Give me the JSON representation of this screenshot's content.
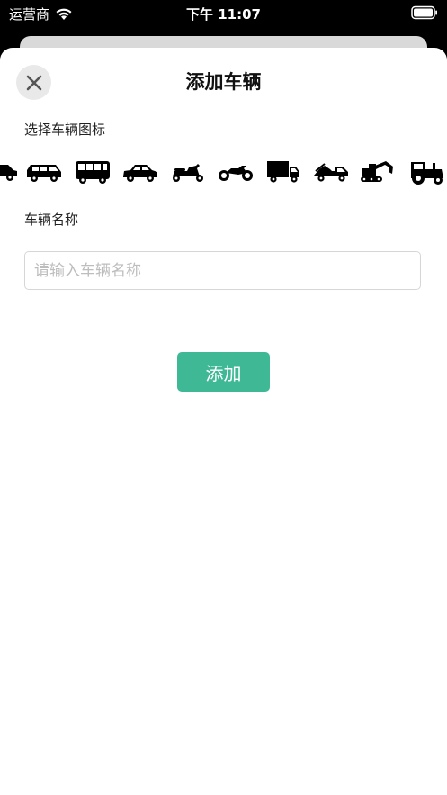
{
  "status_bar": {
    "carrier": "运营商",
    "time": "下午 11:07",
    "wifi_icon": "wifi-icon",
    "battery_icon": "battery-icon"
  },
  "sheet": {
    "title": "添加车辆",
    "close_icon": "close-icon"
  },
  "icon_section": {
    "label": "选择车辆图标",
    "icons": [
      "car-icon",
      "van-icon",
      "bus-icon",
      "sedan-icon",
      "scooter-icon",
      "motorcycle-icon",
      "truck-icon",
      "tow-truck-icon",
      "excavator-icon",
      "tractor-icon"
    ]
  },
  "name_section": {
    "label": "车辆名称",
    "placeholder": "请输入车辆名称",
    "value": ""
  },
  "add_button": {
    "label": "添加"
  },
  "colors": {
    "accent": "#3fb896",
    "icon": "#000000",
    "close_bg": "#e9e9e9"
  }
}
